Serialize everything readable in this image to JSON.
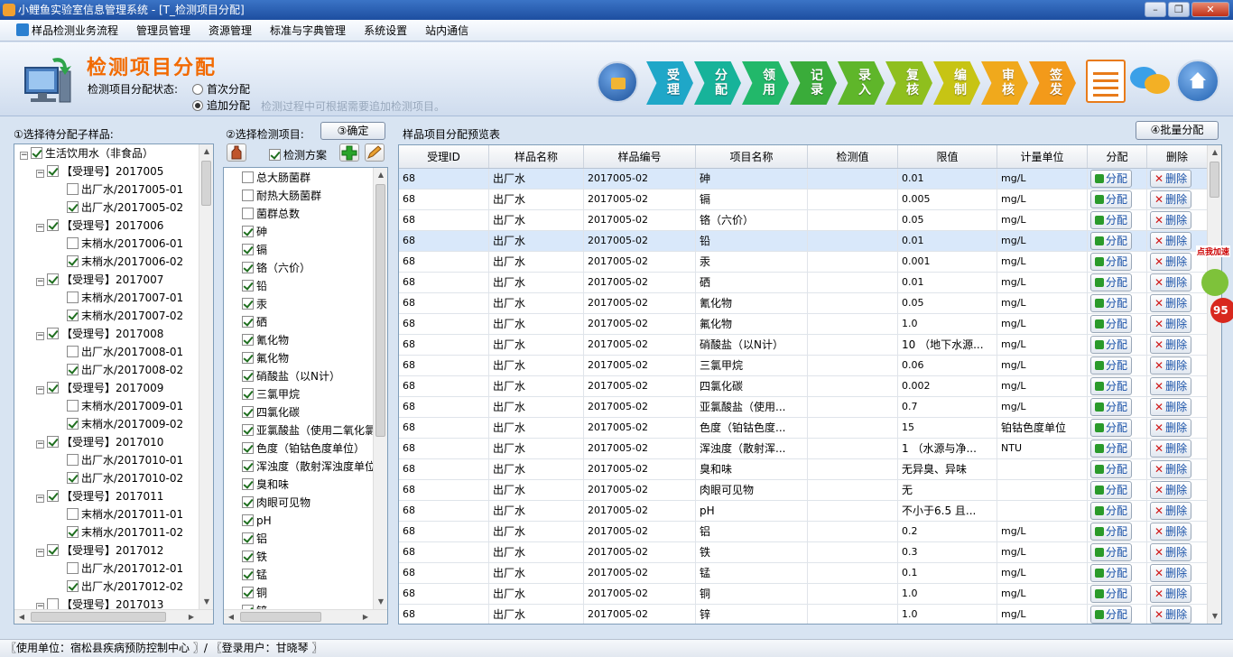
{
  "window": {
    "title": "小鲤鱼实验室信息管理系统 - [T_检测项目分配]",
    "minimize": "–",
    "restore": "❐",
    "close": "✕"
  },
  "menu": [
    "样品检测业务流程",
    "管理员管理",
    "资源管理",
    "标准与字典管理",
    "系统设置",
    "站内通信"
  ],
  "header": {
    "title": "检测项目分配",
    "status_label": "检测项目分配状态:",
    "radio_first": "首次分配",
    "radio_add": "追加分配",
    "hint": "检测过程中可根据需要追加检测项目。"
  },
  "workflow": [
    {
      "label": "受理",
      "color": "#1fa7c8"
    },
    {
      "label": "分配",
      "color": "#17b39a"
    },
    {
      "label": "领用",
      "color": "#22b86a"
    },
    {
      "label": "记录",
      "color": "#3aac3a"
    },
    {
      "label": "录入",
      "color": "#5fb62a"
    },
    {
      "label": "复核",
      "color": "#8fbf1e"
    },
    {
      "label": "编制",
      "color": "#c7c414"
    },
    {
      "label": "审核",
      "color": "#f0a91c"
    },
    {
      "label": "签发",
      "color": "#f39a1a"
    }
  ],
  "left": {
    "label": "①选择待分配子样品:",
    "root": "生活饮用水（非食品）",
    "groups": [
      {
        "name": "【受理号】2017005",
        "children": [
          {
            "name": "出厂水/2017005-01",
            "checked": false
          },
          {
            "name": "出厂水/2017005-02",
            "checked": true
          }
        ]
      },
      {
        "name": "【受理号】2017006",
        "children": [
          {
            "name": "末梢水/2017006-01",
            "checked": false
          },
          {
            "name": "末梢水/2017006-02",
            "checked": true
          }
        ]
      },
      {
        "name": "【受理号】2017007",
        "children": [
          {
            "name": "末梢水/2017007-01",
            "checked": false
          },
          {
            "name": "末梢水/2017007-02",
            "checked": true
          }
        ]
      },
      {
        "name": "【受理号】2017008",
        "children": [
          {
            "name": "出厂水/2017008-01",
            "checked": false
          },
          {
            "name": "出厂水/2017008-02",
            "checked": true
          }
        ]
      },
      {
        "name": "【受理号】2017009",
        "children": [
          {
            "name": "末梢水/2017009-01",
            "checked": false
          },
          {
            "name": "末梢水/2017009-02",
            "checked": true
          }
        ]
      },
      {
        "name": "【受理号】2017010",
        "children": [
          {
            "name": "出厂水/2017010-01",
            "checked": false
          },
          {
            "name": "出厂水/2017010-02",
            "checked": true
          }
        ]
      },
      {
        "name": "【受理号】2017011",
        "children": [
          {
            "name": "末梢水/2017011-01",
            "checked": false
          },
          {
            "name": "末梢水/2017011-02",
            "checked": true
          }
        ]
      },
      {
        "name": "【受理号】2017012",
        "children": [
          {
            "name": "出厂水/2017012-01",
            "checked": false
          },
          {
            "name": "出厂水/2017012-02",
            "checked": true
          }
        ]
      },
      {
        "name": "【受理号】2017013",
        "children": []
      }
    ]
  },
  "middle": {
    "label": "②选择检测项目:",
    "confirm": "③确定",
    "scheme": "检测方案",
    "items": [
      {
        "name": "总大肠菌群",
        "checked": false
      },
      {
        "name": "耐热大肠菌群",
        "checked": false
      },
      {
        "name": "菌群总数",
        "checked": false
      },
      {
        "name": "砷",
        "checked": true
      },
      {
        "name": "镉",
        "checked": true
      },
      {
        "name": "铬（六价）",
        "checked": true
      },
      {
        "name": "铅",
        "checked": true
      },
      {
        "name": "汞",
        "checked": true
      },
      {
        "name": "硒",
        "checked": true
      },
      {
        "name": "氰化物",
        "checked": true
      },
      {
        "name": "氟化物",
        "checked": true
      },
      {
        "name": "硝酸盐（以N计）",
        "checked": true
      },
      {
        "name": "三氯甲烷",
        "checked": true
      },
      {
        "name": "四氯化碳",
        "checked": true
      },
      {
        "name": "亚氯酸盐（使用二氧化氯",
        "checked": true
      },
      {
        "name": "色度（铂钴色度单位）",
        "checked": true
      },
      {
        "name": "浑浊度（散射浑浊度单位",
        "checked": true
      },
      {
        "name": "臭和味",
        "checked": true
      },
      {
        "name": "肉眼可见物",
        "checked": true
      },
      {
        "name": "pH",
        "checked": true
      },
      {
        "name": "铝",
        "checked": true
      },
      {
        "name": "铁",
        "checked": true
      },
      {
        "name": "锰",
        "checked": true
      },
      {
        "name": "铜",
        "checked": true
      },
      {
        "name": "锌",
        "checked": true
      }
    ]
  },
  "right": {
    "label": "样品项目分配预览表",
    "batch": "④批量分配",
    "columns": [
      "受理ID",
      "样品名称",
      "样品编号",
      "项目名称",
      "检测值",
      "限值",
      "计量单位",
      "分配",
      "删除"
    ],
    "assign_label": "分配",
    "delete_label": "删除",
    "rows": [
      [
        "68",
        "出厂水",
        "2017005-02",
        "砷",
        "",
        "0.01",
        "mg/L"
      ],
      [
        "68",
        "出厂水",
        "2017005-02",
        "镉",
        "",
        "0.005",
        "mg/L"
      ],
      [
        "68",
        "出厂水",
        "2017005-02",
        "铬（六价）",
        "",
        "0.05",
        "mg/L"
      ],
      [
        "68",
        "出厂水",
        "2017005-02",
        "铅",
        "",
        "0.01",
        "mg/L"
      ],
      [
        "68",
        "出厂水",
        "2017005-02",
        "汞",
        "",
        "0.001",
        "mg/L"
      ],
      [
        "68",
        "出厂水",
        "2017005-02",
        "硒",
        "",
        "0.01",
        "mg/L"
      ],
      [
        "68",
        "出厂水",
        "2017005-02",
        "氰化物",
        "",
        "0.05",
        "mg/L"
      ],
      [
        "68",
        "出厂水",
        "2017005-02",
        "氟化物",
        "",
        "1.0",
        "mg/L"
      ],
      [
        "68",
        "出厂水",
        "2017005-02",
        "硝酸盐（以N计）",
        "",
        "10 （地下水源...",
        "mg/L"
      ],
      [
        "68",
        "出厂水",
        "2017005-02",
        "三氯甲烷",
        "",
        "0.06",
        "mg/L"
      ],
      [
        "68",
        "出厂水",
        "2017005-02",
        "四氯化碳",
        "",
        "0.002",
        "mg/L"
      ],
      [
        "68",
        "出厂水",
        "2017005-02",
        "亚氯酸盐（使用...",
        "",
        "0.7",
        "mg/L"
      ],
      [
        "68",
        "出厂水",
        "2017005-02",
        "色度（铂钴色度...",
        "",
        "15",
        "铂钴色度单位"
      ],
      [
        "68",
        "出厂水",
        "2017005-02",
        "浑浊度（散射浑...",
        "",
        "1 （水源与净...",
        "NTU"
      ],
      [
        "68",
        "出厂水",
        "2017005-02",
        "臭和味",
        "",
        "无异臭、异味",
        ""
      ],
      [
        "68",
        "出厂水",
        "2017005-02",
        "肉眼可见物",
        "",
        "无",
        ""
      ],
      [
        "68",
        "出厂水",
        "2017005-02",
        "pH",
        "",
        "不小于6.5 且...",
        ""
      ],
      [
        "68",
        "出厂水",
        "2017005-02",
        "铝",
        "",
        "0.2",
        "mg/L"
      ],
      [
        "68",
        "出厂水",
        "2017005-02",
        "铁",
        "",
        "0.3",
        "mg/L"
      ],
      [
        "68",
        "出厂水",
        "2017005-02",
        "锰",
        "",
        "0.1",
        "mg/L"
      ],
      [
        "68",
        "出厂水",
        "2017005-02",
        "铜",
        "",
        "1.0",
        "mg/L"
      ],
      [
        "68",
        "出厂水",
        "2017005-02",
        "锌",
        "",
        "1.0",
        "mg/L"
      ]
    ]
  },
  "ad": {
    "tag": "点我加速",
    "value": "95"
  },
  "status": "〖使用单位：宿松县疾病预防控制中心 〗/ 〖登录用户：甘晓琴 〗"
}
